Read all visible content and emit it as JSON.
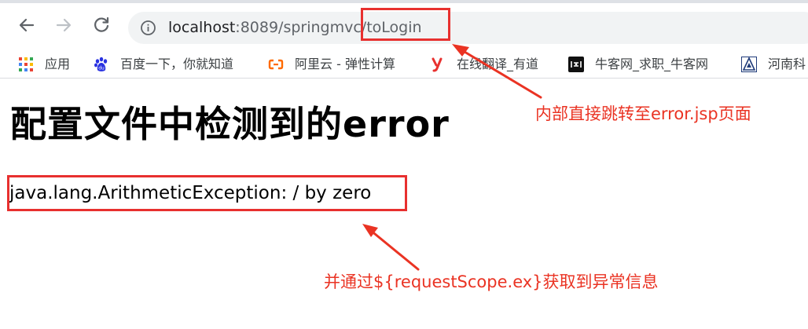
{
  "browser": {
    "url_host": "localhost",
    "url_rest": ":8089/springmvc/toLogin",
    "icons": {
      "back": "arrow-left-icon",
      "forward": "arrow-right-icon",
      "reload": "reload-icon",
      "site_info": "info-circle-icon"
    }
  },
  "bookmarks": [
    {
      "label": "应用",
      "icon": "apps-grid-icon"
    },
    {
      "label": "百度一下，你就知道",
      "icon": "baidu-paw-icon"
    },
    {
      "label": "阿里云 - 弹性计算",
      "icon": "aliyun-icon"
    },
    {
      "label": "在线翻译_有道",
      "icon": "youdao-icon"
    },
    {
      "label": "牛客网_求职_牛客网",
      "icon": "nowcoder-icon"
    },
    {
      "label": "河南科",
      "icon": "university-icon"
    }
  ],
  "page": {
    "title": "配置文件中检测到的error",
    "error_message": "java.lang.ArithmeticException: / by zero"
  },
  "annotations": {
    "redirect_note": "内部直接跳转至error.jsp页面",
    "scope_note": "并通过${requestScope.ex}获取到异常信息",
    "color": "#ea3323"
  }
}
